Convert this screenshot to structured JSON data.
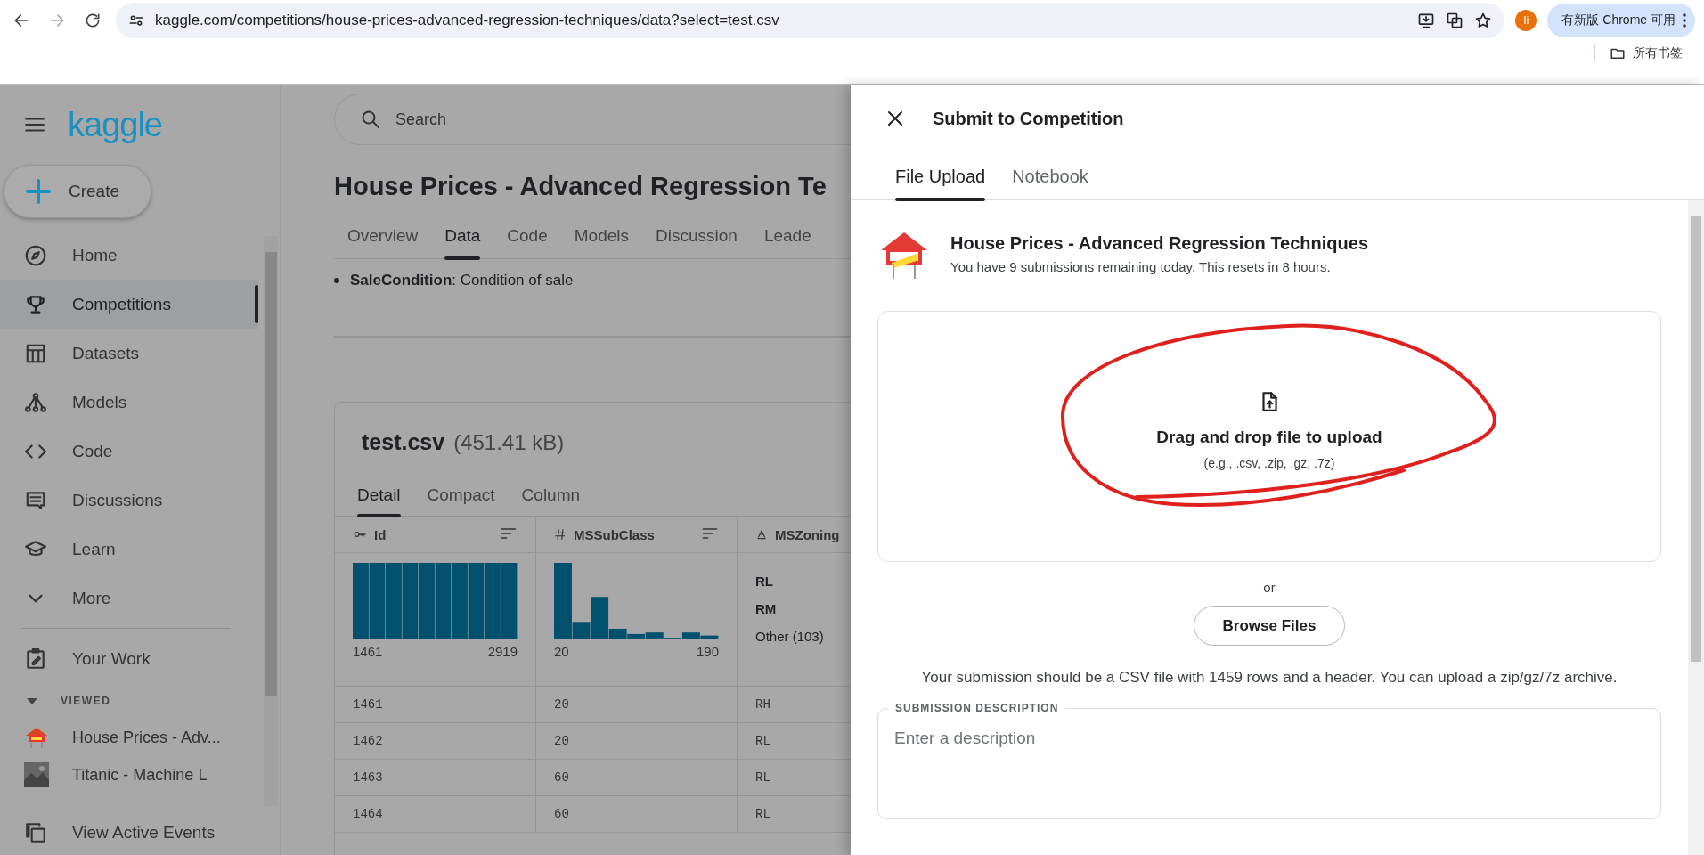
{
  "browser": {
    "url": "kaggle.com/competitions/house-prices-advanced-regression-techniques/data?select=test.csv",
    "profile": "li",
    "update_button": "有新版 Chrome 可用",
    "bookmarks_folder": "所有书签"
  },
  "sidebar": {
    "logo": "kaggle",
    "create": "Create",
    "items": [
      {
        "label": "Home",
        "kind": "compass",
        "selected": false
      },
      {
        "label": "Competitions",
        "kind": "trophy",
        "selected": true
      },
      {
        "label": "Datasets",
        "kind": "table",
        "selected": false
      },
      {
        "label": "Models",
        "kind": "nodes",
        "selected": false
      },
      {
        "label": "Code",
        "kind": "code",
        "selected": false
      },
      {
        "label": "Discussions",
        "kind": "chat",
        "selected": false
      },
      {
        "label": "Learn",
        "kind": "cap",
        "selected": false
      },
      {
        "label": "More",
        "kind": "chevron",
        "selected": false
      }
    ],
    "your_work": "Your Work",
    "viewed": {
      "label": "VIEWED",
      "expanded": true,
      "items": [
        {
          "label": "House Prices - Adv...",
          "kind": "house"
        },
        {
          "label": "Titanic - Machine L",
          "kind": "picture"
        }
      ]
    },
    "footer": "View Active Events"
  },
  "main": {
    "search_placeholder": "Search",
    "title": "House Prices - Advanced Regression Te",
    "tabs": [
      {
        "label": "Overview",
        "selected": false
      },
      {
        "label": "Data",
        "selected": true
      },
      {
        "label": "Code",
        "selected": false
      },
      {
        "label": "Models",
        "selected": false
      },
      {
        "label": "Discussion",
        "selected": false
      },
      {
        "label": "Leade",
        "selected": false
      }
    ],
    "bullet": "**SaleCondition**: Condition of sale",
    "file": {
      "name": "test.csv",
      "size": "(451.41 kB)",
      "view_tabs": [
        {
          "label": "Detail",
          "selected": true
        },
        {
          "label": "Compact",
          "selected": false
        },
        {
          "label": "Column",
          "selected": false
        }
      ],
      "columns": [
        {
          "kind": "key",
          "name": "Id",
          "sortable": true,
          "summary": {
            "kind": "histogram",
            "min": "1461",
            "max": "2919"
          }
        },
        {
          "kind": "number",
          "name": "MSSubClass",
          "sortable": true,
          "summary": {
            "kind": "histogram",
            "min": "20",
            "max": "190"
          }
        },
        {
          "kind": "string",
          "name": "MSZoning",
          "summary": {
            "kind": "categories",
            "values": [
              "RL",
              "RM",
              "Other (103)"
            ]
          }
        }
      ],
      "rows": [
        [
          "1461",
          "20",
          "RH"
        ],
        [
          "1462",
          "20",
          "RL"
        ],
        [
          "1463",
          "60",
          "RL"
        ],
        [
          "1464",
          "60",
          "RL"
        ]
      ]
    }
  },
  "panel": {
    "title": "Submit to Competition",
    "tabs": [
      {
        "label": "File Upload",
        "selected": true
      },
      {
        "label": "Notebook",
        "selected": false
      }
    ],
    "competition": {
      "title": "House Prices - Advanced Regression Techniques",
      "subtitle": "You have 9 submissions remaining today. This resets in 8 hours."
    },
    "drop": {
      "title": "Drag and drop file to upload",
      "hint": "(e.g., .csv, .zip, .gz, .7z)"
    },
    "or": "or",
    "browse": "Browse Files",
    "info": "Your submission should be a CSV file with 1459 rows and a header. You can upload a zip/gz/7z archive.",
    "description": {
      "legend": "SUBMISSION DESCRIPTION",
      "placeholder": "Enter a description"
    }
  }
}
